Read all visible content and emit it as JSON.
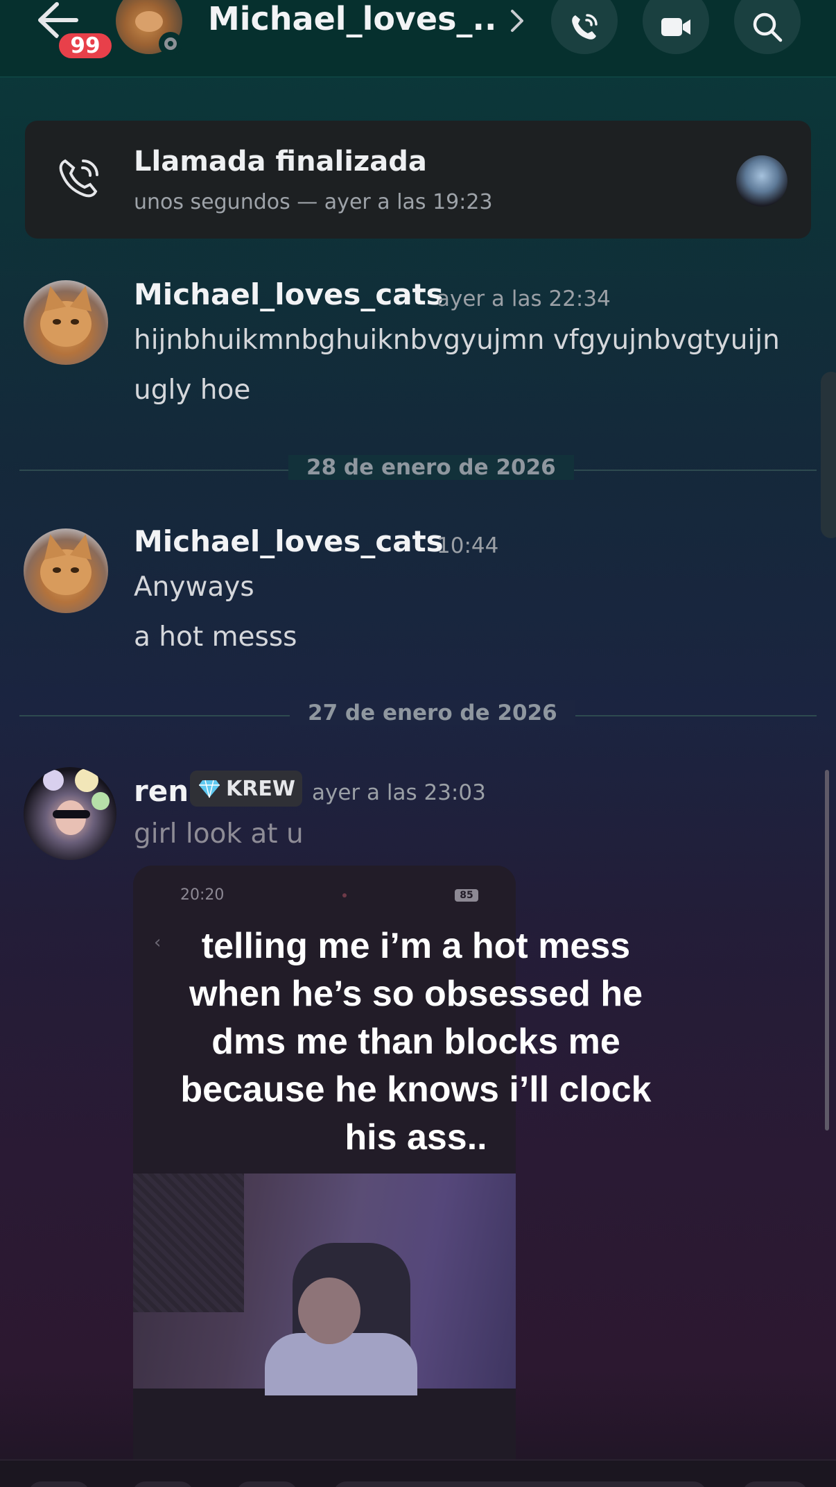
{
  "header": {
    "unread_badge": "99",
    "title": "Michael_loves_...",
    "icons": [
      "back-arrow-icon",
      "chevron-right-icon",
      "phone-icon",
      "video-camera-icon",
      "search-icon"
    ]
  },
  "call_card": {
    "title": "Llamada finalizada",
    "subtitle": "unos segundos — ayer a las 19:23"
  },
  "messages": [
    {
      "author": "Michael_loves_cats",
      "time": "ayer a las 22:34",
      "lines": [
        "hijnbhuikmnbghuiknbvgyujmn  vfgyujnbvgtyuijn",
        "ugly hoe"
      ]
    },
    {
      "author": "Michael_loves_cats",
      "time": "10:44",
      "lines": [
        "Anyways",
        "a hot messs"
      ]
    },
    {
      "author": "ren",
      "tag": "KREW",
      "time": "ayer a las 23:03",
      "lines": [
        "girl look at u"
      ]
    }
  ],
  "dividers": [
    "28 de enero de 2026",
    "27 de enero de 2026"
  ],
  "attachment": {
    "status_time": "20:20",
    "battery": "85",
    "caption": "telling me i’m a hot mess\nwhen he’s so obsessed he\ndms me than blocks me\nbecause he knows i’ll clock\nhis ass.."
  },
  "colors": {
    "badge": "#e8404a",
    "header_bg": "#06302e",
    "card_bg": "#1d2022"
  }
}
